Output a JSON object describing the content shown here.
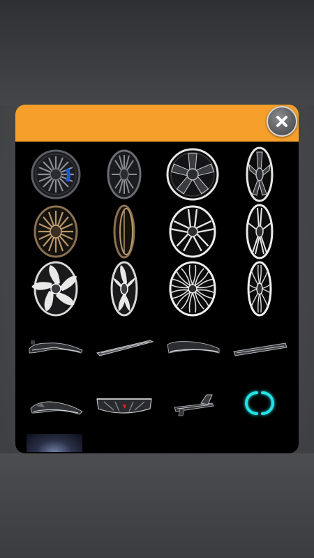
{
  "screen": {
    "title": ""
  },
  "popup": {
    "header_color": "#f6a02b",
    "close_icon": "close-icon"
  },
  "items": [
    {
      "name": "wheel-mesh-blue-caliper",
      "icon": "wheel-icon",
      "category": "wheel"
    },
    {
      "name": "wheel-mesh-dark-angled",
      "icon": "wheel-icon",
      "category": "wheel"
    },
    {
      "name": "wheel-5-spoke-black",
      "icon": "wheel-icon",
      "category": "wheel"
    },
    {
      "name": "wheel-5-spoke-black-angled",
      "icon": "wheel-icon",
      "category": "wheel"
    },
    {
      "name": "wheel-bronze-mesh",
      "icon": "wheel-icon",
      "category": "wheel"
    },
    {
      "name": "wheel-bronze-mesh-side",
      "icon": "wheel-icon",
      "category": "wheel"
    },
    {
      "name": "wheel-twin-spoke-silver",
      "icon": "wheel-icon",
      "category": "wheel"
    },
    {
      "name": "wheel-twin-spoke-silver-angled",
      "icon": "wheel-icon",
      "category": "wheel"
    },
    {
      "name": "wheel-turbine-silver",
      "icon": "wheel-icon",
      "category": "wheel"
    },
    {
      "name": "wheel-turbine-silver-angled",
      "icon": "wheel-icon",
      "category": "wheel"
    },
    {
      "name": "wheel-multi-spoke-chrome",
      "icon": "wheel-icon",
      "category": "wheel"
    },
    {
      "name": "wheel-multi-spoke-chrome-angled",
      "icon": "wheel-icon",
      "category": "wheel"
    },
    {
      "name": "front-lip-spoiler-1",
      "icon": "bodykit-icon",
      "category": "bodykit"
    },
    {
      "name": "side-skirt-1",
      "icon": "bodykit-icon",
      "category": "bodykit"
    },
    {
      "name": "front-lip-spoiler-2",
      "icon": "bodykit-icon",
      "category": "bodykit"
    },
    {
      "name": "side-skirt-2",
      "icon": "bodykit-icon",
      "category": "bodykit"
    },
    {
      "name": "front-splitter-1",
      "icon": "bodykit-icon",
      "category": "bodykit"
    },
    {
      "name": "rear-diffuser-red-light",
      "icon": "bodykit-icon",
      "category": "bodykit"
    },
    {
      "name": "rear-spoiler-wing",
      "icon": "bodykit-icon",
      "category": "bodykit"
    },
    {
      "name": "neon-underglow-cyan",
      "icon": "neon-icon",
      "category": "neon",
      "color": "#22e4e6"
    },
    {
      "name": "background-night-sky",
      "icon": "background-icon",
      "category": "background"
    }
  ]
}
